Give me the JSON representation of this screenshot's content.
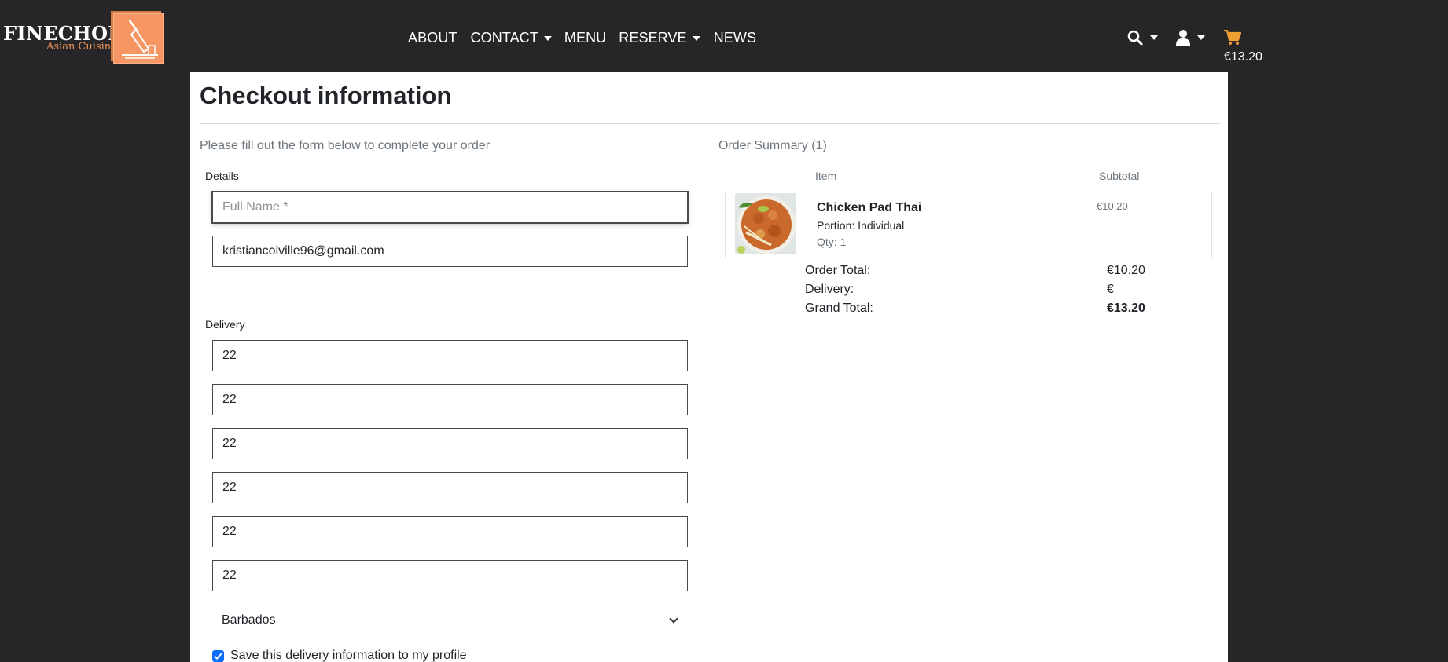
{
  "brand": {
    "name": "FINECHOP",
    "tagline": "Asian Cuisine",
    "accent": "#f59663"
  },
  "nav": {
    "links": [
      {
        "label": "ABOUT",
        "dropdown": false
      },
      {
        "label": "CONTACT",
        "dropdown": true
      },
      {
        "label": "MENU",
        "dropdown": false
      },
      {
        "label": "RESERVE",
        "dropdown": true
      },
      {
        "label": "NEWS",
        "dropdown": false
      }
    ],
    "icons": [
      "search-icon",
      "user-icon",
      "cart-icon"
    ],
    "cart_total": "€13.20",
    "cart_color": "#f0a033"
  },
  "page": {
    "title": "Checkout information",
    "form_intro": "Please fill out the form below to complete your order",
    "details_label": "Details",
    "delivery_label": "Delivery"
  },
  "form": {
    "full_name": {
      "value": "",
      "placeholder": "Full Name *"
    },
    "email": {
      "value": "kristiancolville96@gmail.com",
      "placeholder": ""
    },
    "delivery_fields": [
      "22",
      "22",
      "22",
      "22",
      "22",
      "22"
    ],
    "country": "Barbados",
    "save_info_label": "Save this delivery information to my profile",
    "save_info_checked": true
  },
  "summary": {
    "title": "Order Summary (1)",
    "col_item": "Item",
    "col_subtotal": "Subtotal",
    "items": [
      {
        "name": "Chicken Pad Thai",
        "portion": "Portion: Individual",
        "qty": "Qty: 1",
        "subtotal": "€10.20"
      }
    ],
    "order_total_label": "Order Total:",
    "order_total": "€10.20",
    "delivery_label": "Delivery:",
    "delivery": "€",
    "grand_total_label": "Grand Total:",
    "grand_total": "€13.20"
  }
}
